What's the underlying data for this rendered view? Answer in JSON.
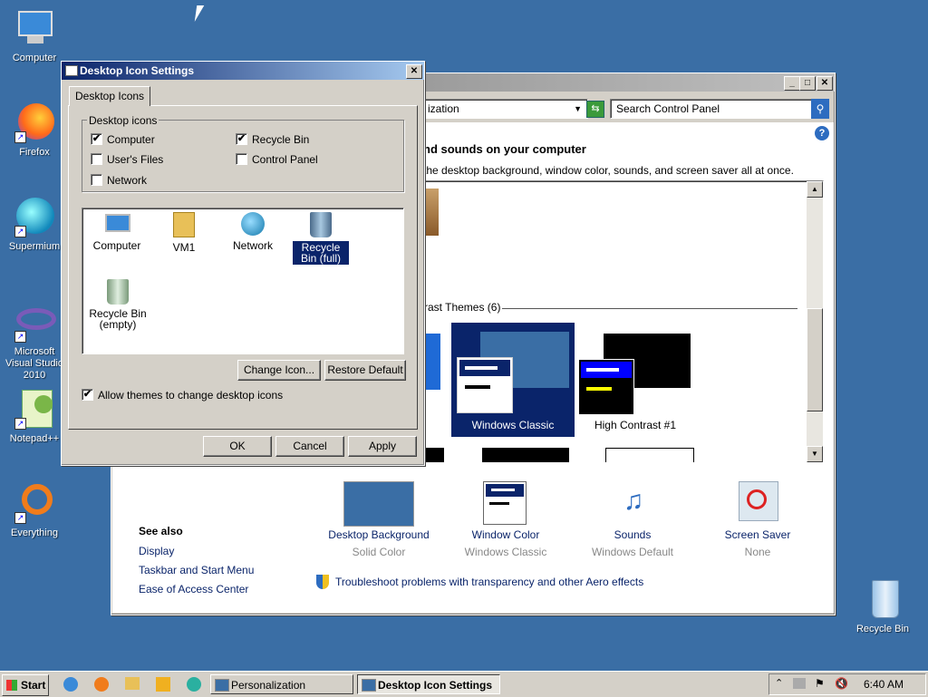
{
  "desktop": {
    "icons": [
      {
        "label": "Computer"
      },
      {
        "label": "Firefox"
      },
      {
        "label": "Supermium"
      },
      {
        "label": "Microsoft Visual Studio 2010"
      },
      {
        "label": "Notepad++"
      },
      {
        "label": "Everything"
      },
      {
        "label": "Recycle Bin"
      }
    ]
  },
  "personalization": {
    "address_text": "ization",
    "search_placeholder": "Search Control Panel",
    "heading": "nd sounds on your computer",
    "subheading": "the desktop background, window color, sounds, and screen saver all at once.",
    "theme_group_label": "rast Themes (6)",
    "themes": [
      {
        "label": "Windows Classic"
      },
      {
        "label": "High Contrast #1"
      }
    ],
    "left_partial_label": "c",
    "bottom_items": [
      {
        "label": "Desktop Background",
        "sub": "Solid Color"
      },
      {
        "label": "Window Color",
        "sub": "Windows Classic"
      },
      {
        "label": "Sounds",
        "sub": "Windows Default"
      },
      {
        "label": "Screen Saver",
        "sub": "None"
      }
    ],
    "see_also": {
      "title": "See also",
      "links": [
        "Display",
        "Taskbar and Start Menu",
        "Ease of Access Center"
      ]
    },
    "troubleshoot": "Troubleshoot problems with transparency and other Aero effects"
  },
  "dialog": {
    "title": "Desktop Icon Settings",
    "tab": "Desktop Icons",
    "group_label": "Desktop icons",
    "checkboxes": [
      {
        "label": "Computer",
        "checked": "✔"
      },
      {
        "label": "Recycle Bin",
        "checked": "✔"
      },
      {
        "label": "User's Files",
        "checked": ""
      },
      {
        "label": "Control Panel",
        "checked": ""
      },
      {
        "label": "Network",
        "checked": ""
      }
    ],
    "icon_list": [
      {
        "label": "Computer"
      },
      {
        "label": "VM1"
      },
      {
        "label": "Network"
      },
      {
        "label": "Recycle Bin (full)"
      },
      {
        "label": "Recycle Bin (empty)"
      }
    ],
    "change_icon": "Change Icon...",
    "restore_default": "Restore Default",
    "allow_themes": "Allow themes to change desktop icons",
    "allow_checked": "✔",
    "ok": "OK",
    "cancel": "Cancel",
    "apply": "Apply"
  },
  "taskbar": {
    "start": "Start",
    "tasks": [
      "Personalization",
      "Desktop Icon Settings"
    ],
    "clock": "6:40 AM"
  }
}
